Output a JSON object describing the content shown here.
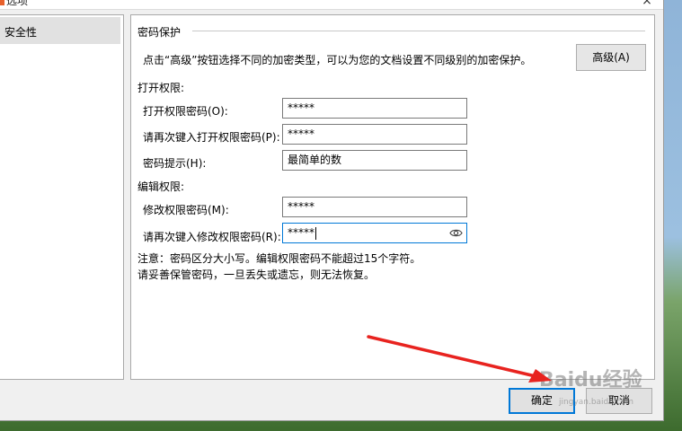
{
  "window": {
    "title": "选项"
  },
  "nav": {
    "items": [
      {
        "label": "安全性",
        "selected": true
      }
    ]
  },
  "encryption": {
    "group_title": "密码保护",
    "description": "点击“高级”按钮选择不同的加密类型，可以为您的文档设置不同级别的加密保护。",
    "advanced_button": "高级(A)"
  },
  "open_permission": {
    "section_title": "打开权限:",
    "password_label": "打开权限密码(O):",
    "password_value": "*****",
    "confirm_label": "请再次键入打开权限密码(P):",
    "confirm_value": "*****",
    "hint_label": "密码提示(H):",
    "hint_value": "最简单的数"
  },
  "edit_permission": {
    "section_title": "编辑权限:",
    "password_label": "修改权限密码(M):",
    "password_value": "*****",
    "confirm_label": "请再次键入修改权限密码(R):",
    "confirm_value": "*****"
  },
  "notes": {
    "line1": "注意：密码区分大小写。编辑权限密码不能超过15个字符。",
    "line2": "请妥善保管密码，一旦丢失或遗忘，则无法恢复。"
  },
  "footer": {
    "ok_label": "确定",
    "cancel_label": "取消"
  },
  "watermark": {
    "text": "Baidu经验",
    "sub": "jingyan.baidu.com"
  },
  "colors": {
    "accent": "#0078d7",
    "arrow": "#e8231f",
    "selected_nav": "#e1e1e1"
  },
  "icons": {
    "eye": "eye-icon",
    "close": "close-icon"
  }
}
